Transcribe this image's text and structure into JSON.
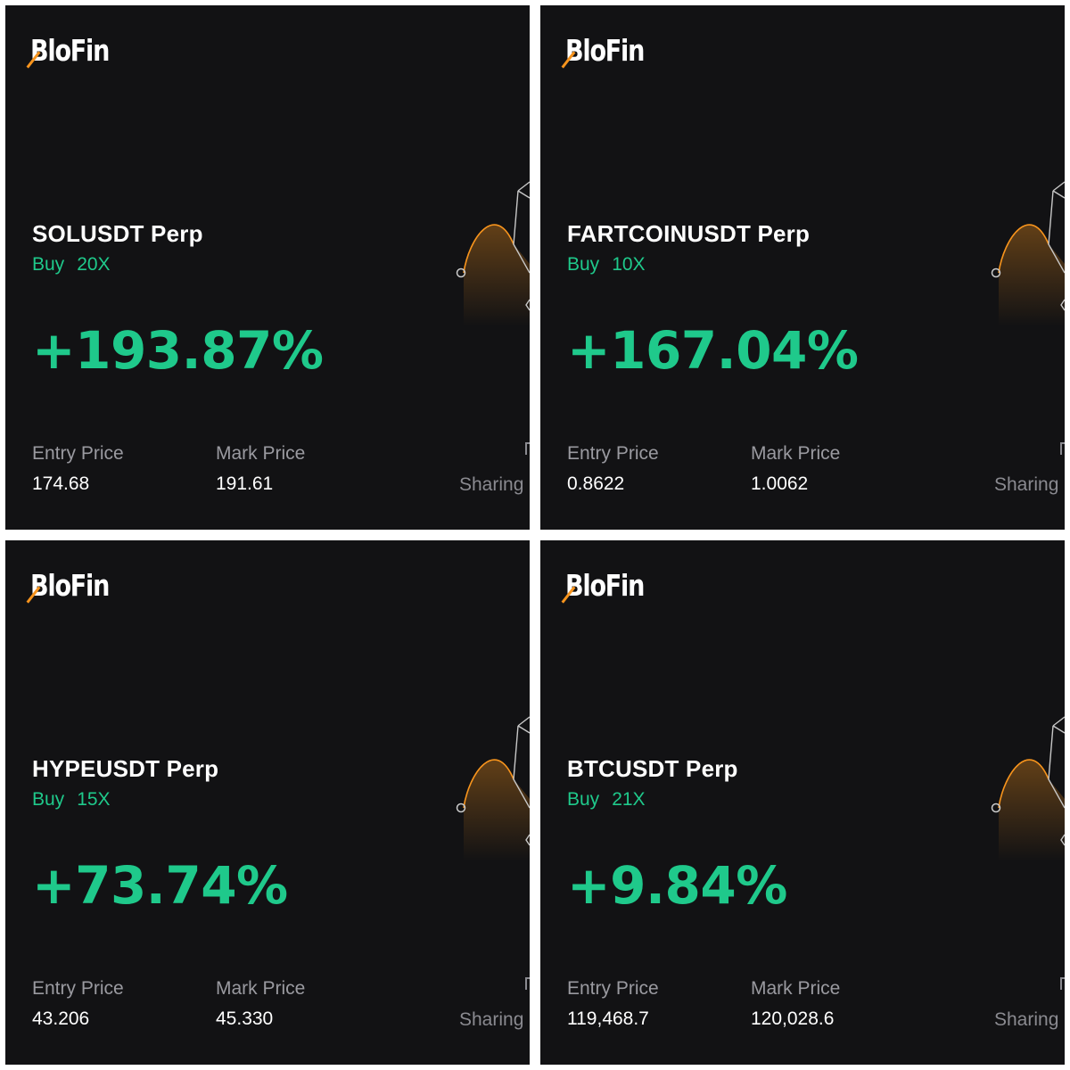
{
  "brand": {
    "name": "BloFin",
    "accent_color": "#f7941d",
    "gain_color": "#1fc98b",
    "background_color": "#121214"
  },
  "cards": [
    {
      "pair": "SOLUSDT Perp",
      "side": "Buy",
      "leverage": "20X",
      "pnl_percent": "+193.87%",
      "entry_label": "Entry Price",
      "entry_price": "174.68",
      "mark_label": "Mark Price",
      "mark_price": "191.61",
      "sharing_text": "Sharing"
    },
    {
      "pair": "FARTCOINUSDT Perp",
      "side": "Buy",
      "leverage": "10X",
      "pnl_percent": "+167.04%",
      "entry_label": "Entry Price",
      "entry_price": "0.8622",
      "mark_label": "Mark Price",
      "mark_price": "1.0062",
      "sharing_text": "Sharing"
    },
    {
      "pair": "HYPEUSDT Perp",
      "side": "Buy",
      "leverage": "15X",
      "pnl_percent": "+73.74%",
      "entry_label": "Entry Price",
      "entry_price": "43.206",
      "mark_label": "Mark Price",
      "mark_price": "45.330",
      "sharing_text": "Sharing"
    },
    {
      "pair": "BTCUSDT Perp",
      "side": "Buy",
      "leverage": "21X",
      "pnl_percent": "+9.84%",
      "entry_label": "Entry Price",
      "entry_price": "119,468.7",
      "mark_label": "Mark Price",
      "mark_price": "120,028.6",
      "sharing_text": "Sharing"
    }
  ]
}
